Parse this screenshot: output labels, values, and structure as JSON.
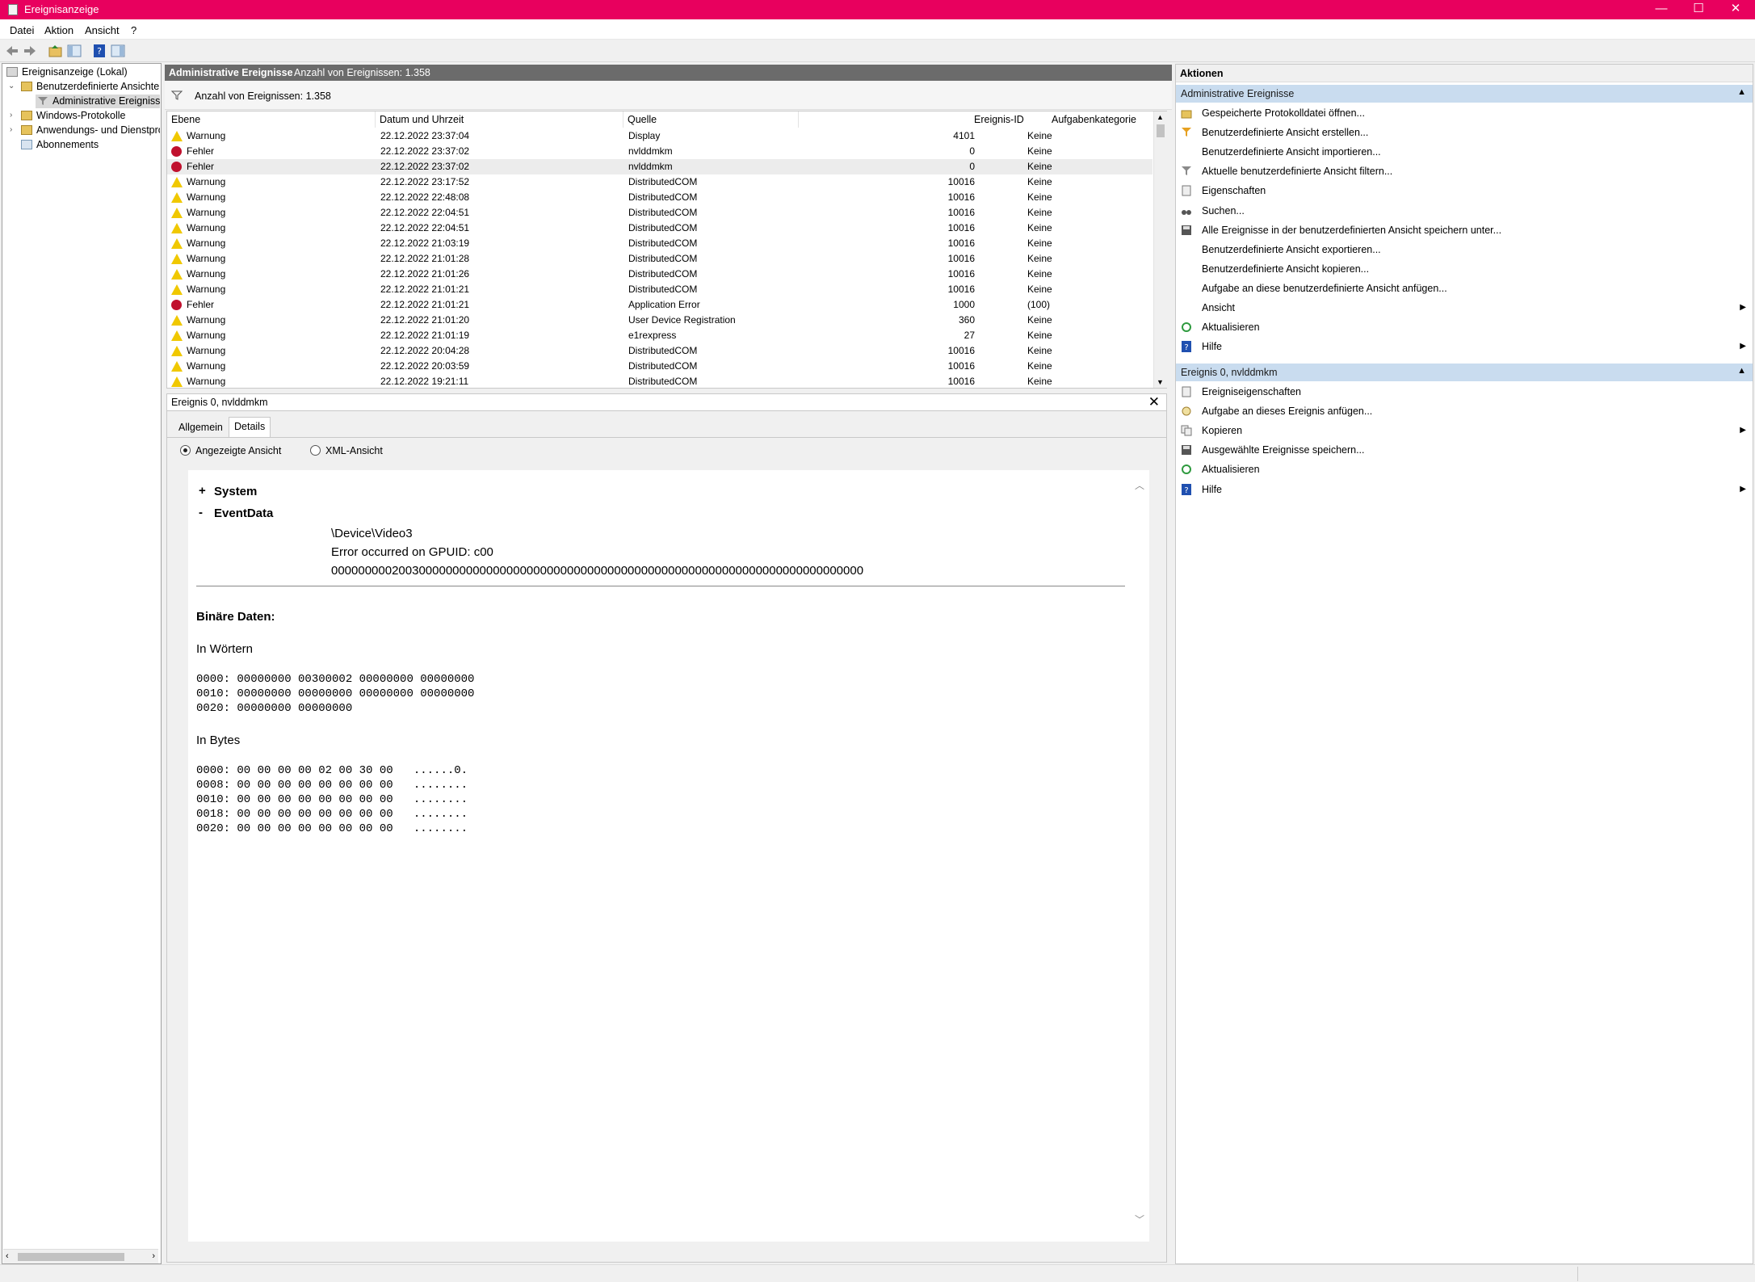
{
  "window": {
    "title": "Ereignisanzeige",
    "controls": {
      "minimize": "—",
      "maximize": "☐",
      "close": "✕"
    }
  },
  "menu": [
    "Datei",
    "Aktion",
    "Ansicht",
    "?"
  ],
  "toolbar_icons": [
    "back-icon",
    "forward-icon",
    "up-folder-icon",
    "show-hide-tree-icon",
    "help-icon",
    "show-hide-action-pane-icon"
  ],
  "tree": {
    "root": "Ereignisanzeige (Lokal)",
    "custom_views": "Benutzerdefinierte Ansichten",
    "admin_events": "Administrative Ereignisse",
    "windows_logs": "Windows-Protokolle",
    "app_logs": "Anwendungs- und Dienstprotokolle",
    "subscriptions": "Abonnements"
  },
  "middle": {
    "header_title": "Administrative Ereignisse",
    "header_count": "Anzahl von Ereignissen: 1.358",
    "filter_text": "Anzahl von Ereignissen: 1.358",
    "columns": [
      "Ebene",
      "Datum und Uhrzeit",
      "Quelle",
      "Ereignis-ID",
      "Aufgabenkategorie"
    ],
    "rows": [
      {
        "level": "Warnung",
        "type": "warn",
        "date": "22.12.2022 23:37:04",
        "source": "Display",
        "id": "4101",
        "category": "Keine"
      },
      {
        "level": "Fehler",
        "type": "err",
        "date": "22.12.2022 23:37:02",
        "source": "nvlddmkm",
        "id": "0",
        "category": "Keine"
      },
      {
        "level": "Fehler",
        "type": "err",
        "date": "22.12.2022 23:37:02",
        "source": "nvlddmkm",
        "id": "0",
        "category": "Keine",
        "selected": true
      },
      {
        "level": "Warnung",
        "type": "warn",
        "date": "22.12.2022 23:17:52",
        "source": "DistributedCOM",
        "id": "10016",
        "category": "Keine"
      },
      {
        "level": "Warnung",
        "type": "warn",
        "date": "22.12.2022 22:48:08",
        "source": "DistributedCOM",
        "id": "10016",
        "category": "Keine"
      },
      {
        "level": "Warnung",
        "type": "warn",
        "date": "22.12.2022 22:04:51",
        "source": "DistributedCOM",
        "id": "10016",
        "category": "Keine"
      },
      {
        "level": "Warnung",
        "type": "warn",
        "date": "22.12.2022 22:04:51",
        "source": "DistributedCOM",
        "id": "10016",
        "category": "Keine"
      },
      {
        "level": "Warnung",
        "type": "warn",
        "date": "22.12.2022 21:03:19",
        "source": "DistributedCOM",
        "id": "10016",
        "category": "Keine"
      },
      {
        "level": "Warnung",
        "type": "warn",
        "date": "22.12.2022 21:01:28",
        "source": "DistributedCOM",
        "id": "10016",
        "category": "Keine"
      },
      {
        "level": "Warnung",
        "type": "warn",
        "date": "22.12.2022 21:01:26",
        "source": "DistributedCOM",
        "id": "10016",
        "category": "Keine"
      },
      {
        "level": "Warnung",
        "type": "warn",
        "date": "22.12.2022 21:01:21",
        "source": "DistributedCOM",
        "id": "10016",
        "category": "Keine"
      },
      {
        "level": "Fehler",
        "type": "err",
        "date": "22.12.2022 21:01:21",
        "source": "Application Error",
        "id": "1000",
        "category": "(100)"
      },
      {
        "level": "Warnung",
        "type": "warn",
        "date": "22.12.2022 21:01:20",
        "source": "User Device Registration",
        "id": "360",
        "category": "Keine"
      },
      {
        "level": "Warnung",
        "type": "warn",
        "date": "22.12.2022 21:01:19",
        "source": "e1rexpress",
        "id": "27",
        "category": "Keine"
      },
      {
        "level": "Warnung",
        "type": "warn",
        "date": "22.12.2022 20:04:28",
        "source": "DistributedCOM",
        "id": "10016",
        "category": "Keine"
      },
      {
        "level": "Warnung",
        "type": "warn",
        "date": "22.12.2022 20:03:59",
        "source": "DistributedCOM",
        "id": "10016",
        "category": "Keine"
      },
      {
        "level": "Warnung",
        "type": "warn",
        "date": "22.12.2022 19:21:11",
        "source": "DistributedCOM",
        "id": "10016",
        "category": "Keine"
      }
    ]
  },
  "detail": {
    "title": "Ereignis 0, nvlddmkm",
    "close": "✕",
    "tabs": [
      "Allgemein",
      "Details"
    ],
    "radio_friendly": "Angezeigte Ansicht",
    "radio_xml": "XML-Ansicht",
    "system_toggle": "+",
    "system_label": "System",
    "eventdata_toggle": "-",
    "eventdata_label": "EventData",
    "eventdata_lines": [
      "\\Device\\Video3",
      "Error occurred on GPUID: c00",
      "0000000002003000000000000000000000000000000000000000000000000000000000000000000"
    ],
    "binary_title": "Binäre Daten:",
    "words_title": "In Wörtern",
    "words": [
      "0000: 00000000 00300002 00000000 00000000",
      "0010: 00000000 00000000 00000000 00000000",
      "0020: 00000000 00000000"
    ],
    "bytes_title": "In Bytes",
    "bytes": [
      "0000: 00 00 00 00 02 00 30 00   ......0.",
      "0008: 00 00 00 00 00 00 00 00   ........",
      "0010: 00 00 00 00 00 00 00 00   ........",
      "0018: 00 00 00 00 00 00 00 00   ........",
      "0020: 00 00 00 00 00 00 00 00   ........"
    ]
  },
  "actions": {
    "title": "Aktionen",
    "section1": "Administrative Ereignisse",
    "section1_items": [
      {
        "label": "Gespeicherte Protokolldatei öffnen...",
        "icon": "open-folder-icon"
      },
      {
        "label": "Benutzerdefinierte Ansicht erstellen...",
        "icon": "create-filter-icon"
      },
      {
        "label": "Benutzerdefinierte Ansicht importieren...",
        "icon": ""
      },
      {
        "label": "Aktuelle benutzerdefinierte Ansicht filtern...",
        "icon": "filter-icon"
      },
      {
        "label": "Eigenschaften",
        "icon": "properties-icon"
      },
      {
        "label": "Suchen...",
        "icon": "binoculars-icon"
      },
      {
        "label": "Alle Ereignisse in der benutzerdefinierten Ansicht speichern unter...",
        "icon": "save-icon"
      },
      {
        "label": "Benutzerdefinierte Ansicht exportieren...",
        "icon": ""
      },
      {
        "label": "Benutzerdefinierte Ansicht kopieren...",
        "icon": ""
      },
      {
        "label": "Aufgabe an diese benutzerdefinierte Ansicht anfügen...",
        "icon": ""
      },
      {
        "label": "Ansicht",
        "icon": "",
        "submenu": true
      },
      {
        "label": "Aktualisieren",
        "icon": "refresh-icon"
      },
      {
        "label": "Hilfe",
        "icon": "help-icon",
        "submenu": true
      }
    ],
    "section2": "Ereignis 0, nvlddmkm",
    "section2_items": [
      {
        "label": "Ereigniseigenschaften",
        "icon": "event-properties-icon"
      },
      {
        "label": "Aufgabe an dieses Ereignis anfügen...",
        "icon": "task-icon"
      },
      {
        "label": "Kopieren",
        "icon": "copy-icon",
        "submenu": true
      },
      {
        "label": "Ausgewählte Ereignisse speichern...",
        "icon": "save-icon"
      },
      {
        "label": "Aktualisieren",
        "icon": "refresh-icon"
      },
      {
        "label": "Hilfe",
        "icon": "help-icon",
        "submenu": true
      }
    ]
  },
  "colors": {
    "titlebar": "#e8005e",
    "section_header": "#c9dcef",
    "grid_header_dark": "#6b6b6b",
    "warning": "#f0c800",
    "error": "#c0102d"
  }
}
